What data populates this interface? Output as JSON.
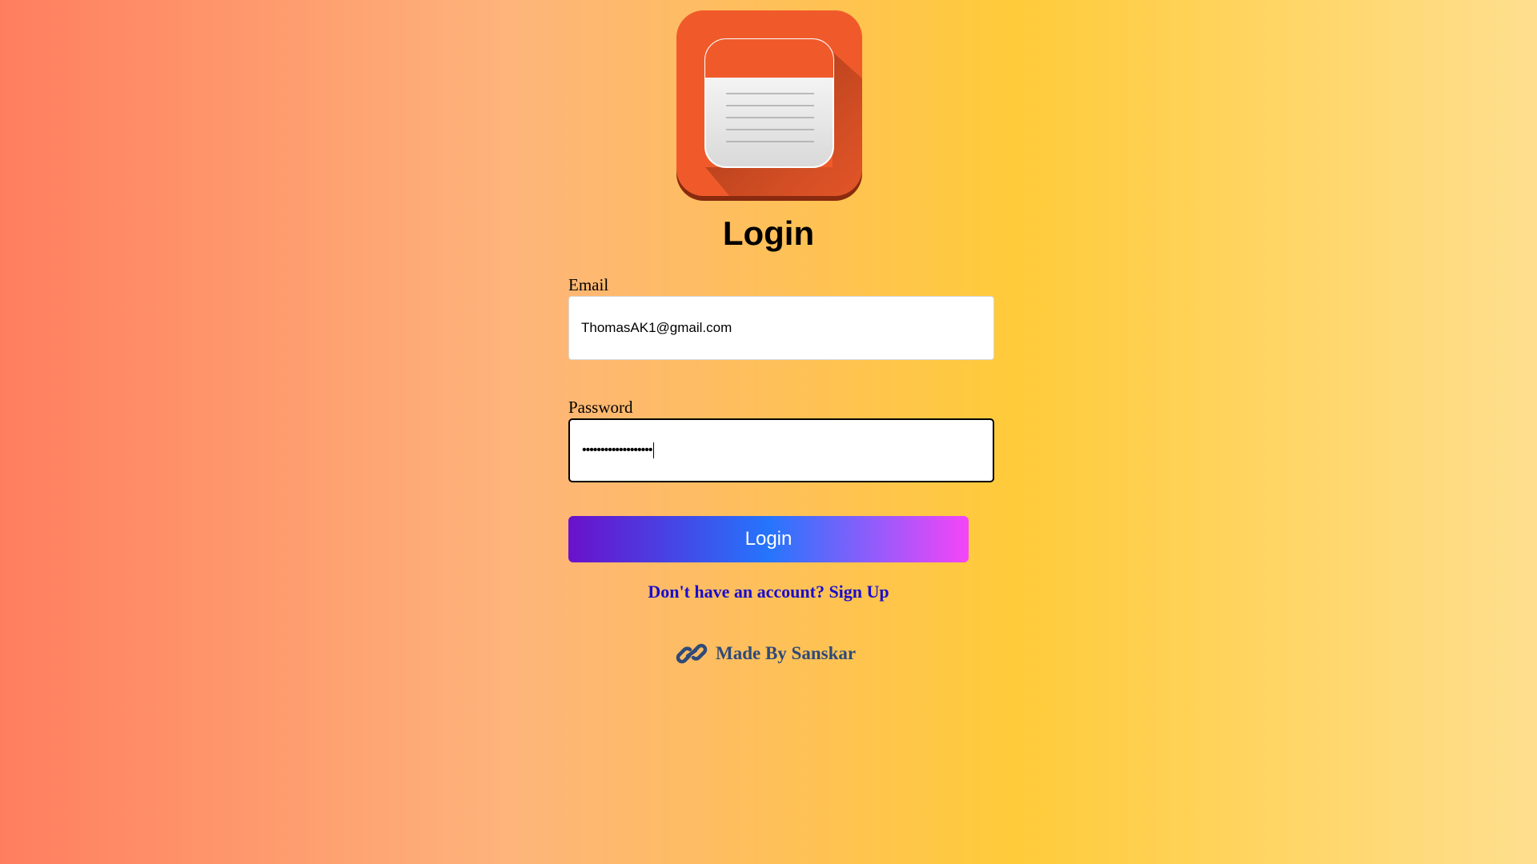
{
  "app": {
    "title": "Login",
    "logo_icon": "notepad-icon"
  },
  "form": {
    "email_label": "Email",
    "email_value": "ThomasAK1@gmail.com",
    "password_label": "Password",
    "password_masked": "•••••••••••••••••••",
    "login_button_label": "Login",
    "signup_link_text": "Don't have an account? Sign Up"
  },
  "footer": {
    "icon": "link-icon",
    "text": "Made By Sanskar"
  },
  "colors": {
    "background_left": "#ff7e5f",
    "background_mid": "#ffcb3a",
    "button_gradient_start": "#6a11cb",
    "button_gradient_mid": "#2575fc",
    "button_gradient_end": "#f545f8",
    "link_color": "#1a0dcc",
    "footer_color": "#2f4a78",
    "logo_orange": "#f05a2b"
  }
}
